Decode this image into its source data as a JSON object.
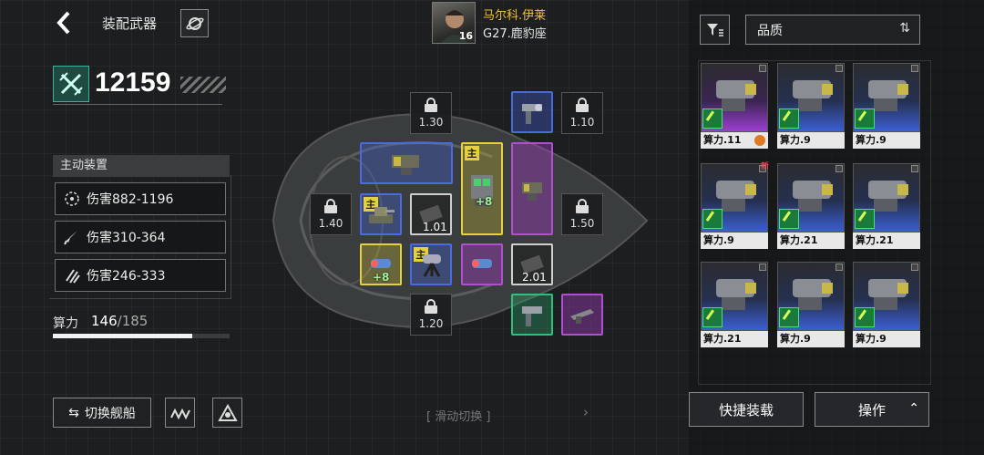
{
  "header": {
    "title": "装配武器",
    "back_icon": "chevron-left-icon",
    "planet_icon": "planet-icon"
  },
  "pilot": {
    "name": "马尔科.伊莱",
    "ship": "G27.鹿豹座",
    "level": "16"
  },
  "power": {
    "value": "12159"
  },
  "active_equipment": {
    "header": "主动装置",
    "stats": [
      {
        "icon": "target-icon",
        "label": "伤害882-1196"
      },
      {
        "icon": "missile-icon",
        "label": "伤害310-364"
      },
      {
        "icon": "multi-missile-icon",
        "label": "伤害246-333"
      }
    ]
  },
  "compute": {
    "label": "算力",
    "current": "146",
    "max": "/185",
    "fraction": 0.789
  },
  "bottom_left": {
    "switch_label": "切换舰船",
    "switch_icon": "swap-icon"
  },
  "center": {
    "slide_hint": "[ 滑动切换 ]",
    "main_tag": "主",
    "locks": [
      "1.30",
      "1.10",
      "1.40",
      "1.50",
      "1.20"
    ],
    "slot_values": [
      "1.01",
      "2.01"
    ],
    "plus": "+8"
  },
  "sort": {
    "label": "品质"
  },
  "cards": [
    {
      "label": "算力.11",
      "color": "purple",
      "gear": true
    },
    {
      "label": "算力.9",
      "color": "blue"
    },
    {
      "label": "算力.9",
      "color": "blue"
    },
    {
      "label": "算力.9",
      "color": "blue",
      "new": "新"
    },
    {
      "label": "算力.21",
      "color": "blue"
    },
    {
      "label": "算力.21",
      "color": "blue"
    },
    {
      "label": "算力.21",
      "color": "blue"
    },
    {
      "label": "算力.9",
      "color": "blue"
    },
    {
      "label": "算力.9",
      "color": "blue"
    }
  ],
  "actions": {
    "quick_equip": "快捷装载",
    "operate": "操作"
  }
}
